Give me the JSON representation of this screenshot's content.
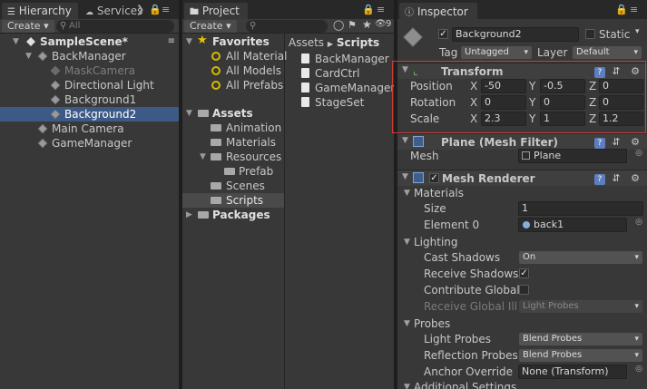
{
  "hierarchy": {
    "tabs": [
      "Hierarchy",
      "Services"
    ],
    "create_label": "Create",
    "search_placeholder": "All",
    "scene_name": "SampleScene*",
    "items": [
      {
        "label": "BackManager",
        "type": "gameobject",
        "expanded": true
      },
      {
        "label": "MaskCamera",
        "type": "gameobject-disabled"
      },
      {
        "label": "Directional Light",
        "type": "gameobject"
      },
      {
        "label": "Background1",
        "type": "gameobject"
      },
      {
        "label": "Background2",
        "type": "gameobject",
        "selected": true
      },
      {
        "label": "Main Camera",
        "type": "gameobject"
      },
      {
        "label": "GameManager",
        "type": "gameobject"
      }
    ]
  },
  "project": {
    "tab": "Project",
    "create_label": "Create",
    "hidden_count": "9",
    "favorites_label": "Favorites",
    "favorites": [
      "All Material",
      "All Models",
      "All Prefabs"
    ],
    "assets_label": "Assets",
    "assets_children": [
      "Animation",
      "Materials",
      "Resources",
      "Prefab",
      "Scenes",
      "Scripts"
    ],
    "packages_label": "Packages",
    "breadcrumb_root": "Assets",
    "breadcrumb_sep": "▶",
    "breadcrumb_current": "Scripts",
    "files": [
      "BackManager",
      "CardCtrl",
      "GameManager",
      "StageSet"
    ]
  },
  "inspector": {
    "tab": "Inspector",
    "object_name": "Background2",
    "active_checked": true,
    "static_label": "Static",
    "tag_label": "Tag",
    "tag_value": "Untagged",
    "layer_label": "Layer",
    "layer_value": "Default",
    "transform": {
      "title": "Transform",
      "position_label": "Position",
      "rotation_label": "Rotation",
      "scale_label": "Scale",
      "axis_x": "X",
      "axis_y": "Y",
      "axis_z": "Z",
      "position": [
        "-50",
        "-0.5",
        "0"
      ],
      "rotation": [
        "0",
        "0",
        "0"
      ],
      "scale": [
        "2.3",
        "1",
        "1.2"
      ]
    },
    "mesh_filter": {
      "title": "Plane (Mesh Filter)",
      "mesh_label": "Mesh",
      "mesh_value": "Plane"
    },
    "mesh_renderer": {
      "title": "Mesh Renderer",
      "materials_label": "Materials",
      "size_label": "Size",
      "size_value": "1",
      "element0_label": "Element 0",
      "element0_value": "back1",
      "lighting_label": "Lighting",
      "cast_shadows_label": "Cast Shadows",
      "cast_shadows_value": "On",
      "receive_shadows_label": "Receive Shadows",
      "contribute_gi_label": "Contribute Global",
      "receive_gi_label": "Receive Global Illu",
      "receive_gi_value": "Light Probes",
      "probes_label": "Probes",
      "light_probes_label": "Light Probes",
      "light_probes_value": "Blend Probes",
      "reflection_probes_label": "Reflection Probes",
      "reflection_probes_value": "Blend Probes",
      "anchor_override_label": "Anchor Override",
      "anchor_override_value": "None (Transform)",
      "additional_label": "Additional Settings"
    }
  },
  "colors": {
    "selection": "#3d5a87",
    "highlight_box": "#d23a3a",
    "panel_bg": "#383838",
    "accent_star": "#e6c200"
  }
}
